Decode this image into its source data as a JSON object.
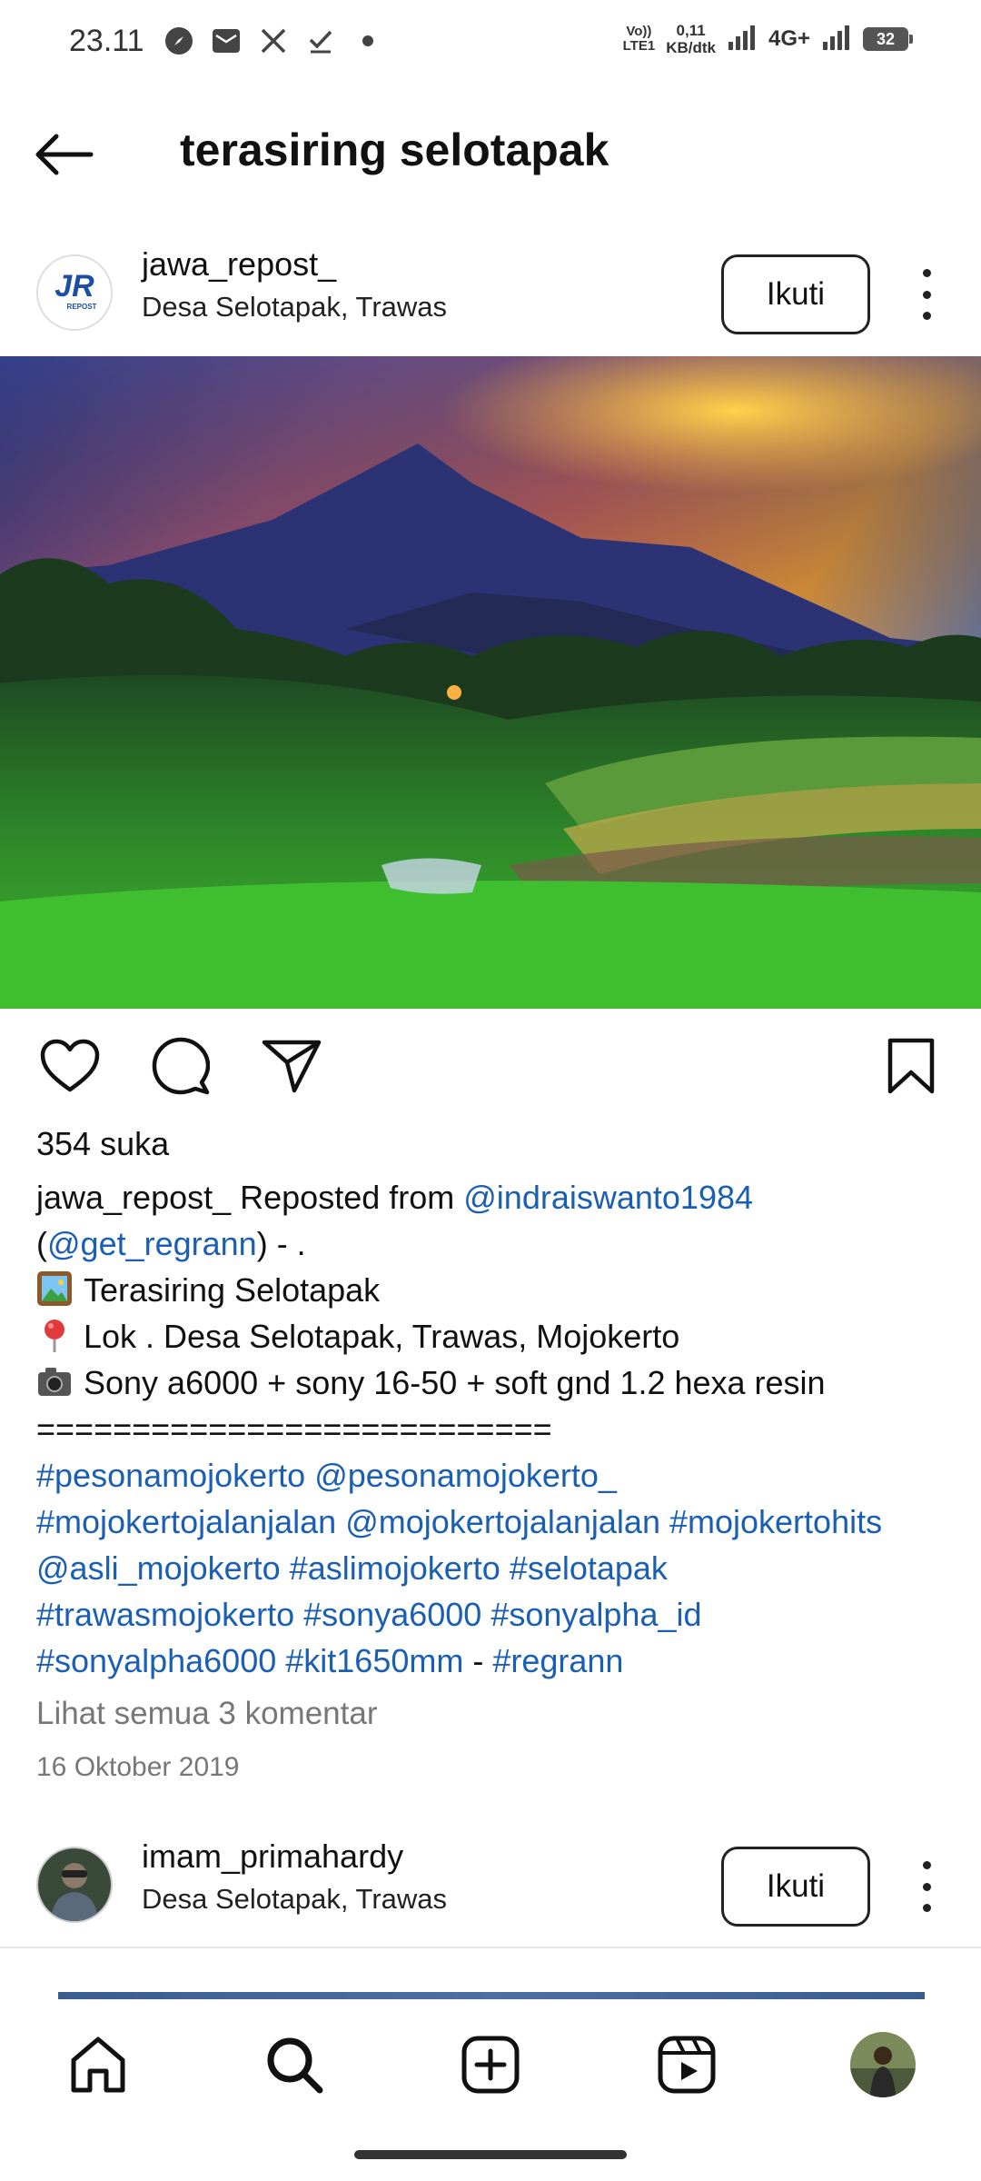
{
  "status_bar": {
    "time": "23.11",
    "volte_top": "Vo))",
    "volte_bottom": "LTE1",
    "speed_value": "0,11",
    "speed_unit": "KB/dtk",
    "network": "4G+",
    "battery": "32",
    "icons": [
      "compass-icon",
      "mail-icon",
      "x-icon",
      "check-icon",
      "dot-icon",
      "signal-icon",
      "signal-icon"
    ]
  },
  "header": {
    "title": "terasiring selotapak",
    "back_icon": "arrow-left-icon"
  },
  "post": {
    "username": "jawa_repost_",
    "location": "Desa Selotapak, Trawas",
    "follow_label": "Ikuti",
    "avatar_logo_text": "JR",
    "avatar_logo_sub": "REPOST",
    "likes": "354 suka",
    "caption": {
      "user": "jawa_repost_",
      "reposted_from": " Reposted from ",
      "mention1": "@indraiswanto1984",
      "paren_open": "(",
      "mention2": "@get_regrann",
      "paren_close": ") - .",
      "line2": "Terasiring Selotapak",
      "line3": "Lok . Desa Selotapak, Trawas, Mojokerto",
      "line4": "Sony a6000 + sony 16-50 + soft gnd 1.2 hexa resin",
      "line5": "===========================",
      "tags": {
        "t1": "#pesonamojokerto",
        "t2": "@pesonamojokerto_",
        "t3": "#mojokertojalanjalan",
        "t4": "@mojokertojalanjalan",
        "t5": "#mojokertohits",
        "t6": "@asli_mojokerto",
        "t7": "#aslimojokerto",
        "t8": "#selotapak",
        "t9": "#trawasmojokerto",
        "t10": "#sonya6000",
        "t11": "#sonyalpha_id",
        "t12": "#sonyalpha6000",
        "t13": "#kit1650mm",
        "sep": " - ",
        "t14": "#regrann"
      }
    },
    "view_comments": "Lihat semua 3 komentar",
    "date": "16 Oktober 2019"
  },
  "next_post": {
    "username": "imam_primahardy",
    "location": "Desa Selotapak, Trawas",
    "follow_label": "Ikuti"
  },
  "bottom_nav": {
    "items": [
      "home-icon",
      "search-icon",
      "add-post-icon",
      "reels-icon",
      "profile-avatar"
    ]
  },
  "colors": {
    "link": "#1a5fb4",
    "muted": "#777777"
  }
}
